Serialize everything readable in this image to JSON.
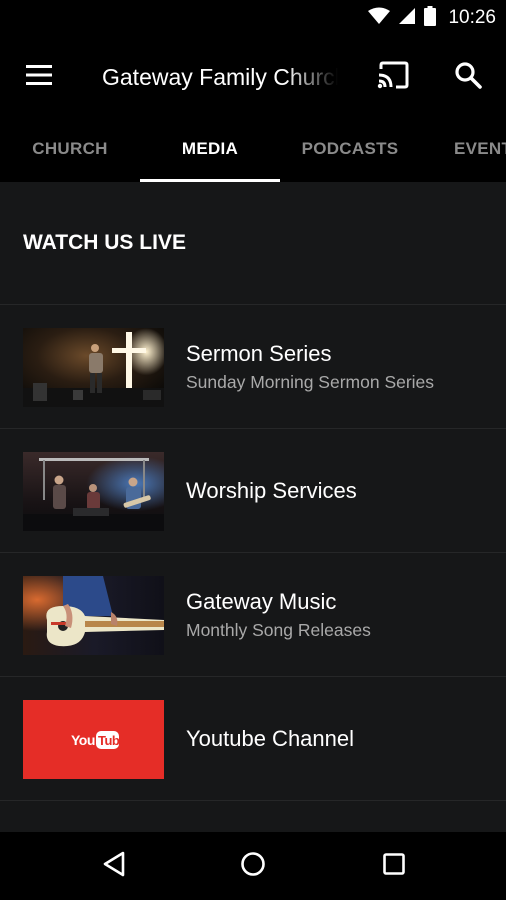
{
  "status_bar": {
    "time": "10:26"
  },
  "app_bar": {
    "title": "Gateway Family Church"
  },
  "tabs": [
    {
      "label": "CHURCH",
      "active": false
    },
    {
      "label": "MEDIA",
      "active": true
    },
    {
      "label": "PODCASTS",
      "active": false
    },
    {
      "label": "EVENTS",
      "active": false
    }
  ],
  "section": {
    "title": "WATCH US LIVE"
  },
  "items": [
    {
      "title": "Sermon Series",
      "subtitle": "Sunday Morning Sermon Series",
      "thumb": "preacher-with-cross"
    },
    {
      "title": "Worship Services",
      "subtitle": "",
      "thumb": "worship-band"
    },
    {
      "title": "Gateway Music",
      "subtitle": "Monthly Song Releases",
      "thumb": "guitar"
    },
    {
      "title": "Youtube Channel",
      "subtitle": "",
      "thumb": "youtube-logo",
      "logo_text": "YouTube"
    }
  ],
  "colors": {
    "background": "#161718",
    "bars": "#000000",
    "youtube_red": "#e52d27",
    "inactive_tab": "#8a8a8a"
  }
}
